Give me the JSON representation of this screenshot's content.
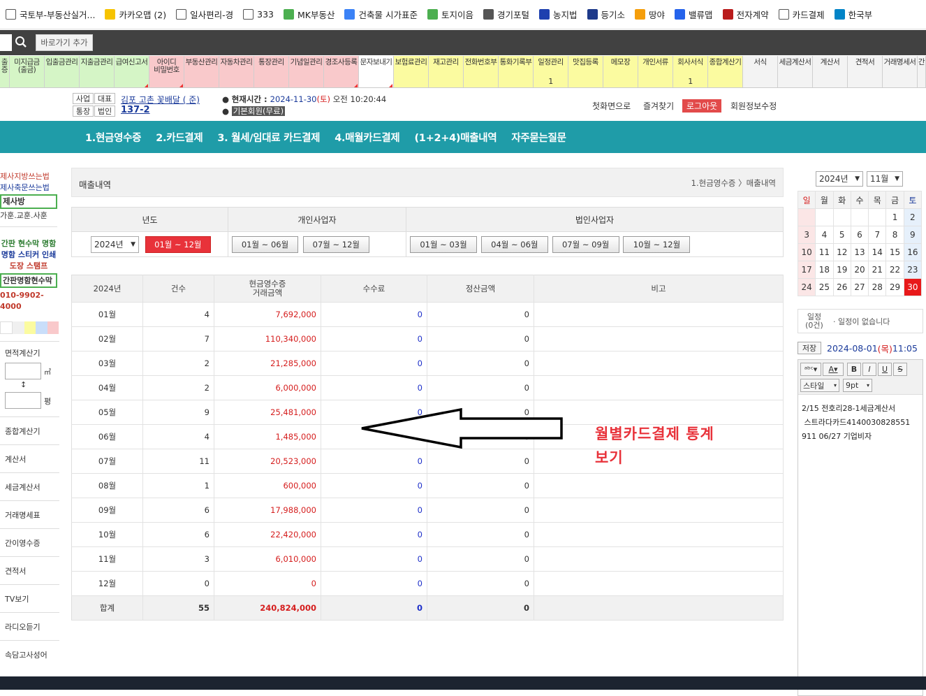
{
  "bookmarks": [
    {
      "label": "국토부-부동산실거...",
      "icon": "page-icon",
      "color": "#ffffff"
    },
    {
      "label": "카카오맵 (2)",
      "icon": "map-pin-icon",
      "color": "#f6c300"
    },
    {
      "label": "일사편리-경",
      "icon": "page-icon",
      "color": "#ffffff"
    },
    {
      "label": "333",
      "icon": "page-icon",
      "color": "#ffffff"
    },
    {
      "label": "MK부동산",
      "icon": "house-icon",
      "color": "#4caf50"
    },
    {
      "label": "건축물 시가표준",
      "icon": "w-icon",
      "color": "#3b82f6"
    },
    {
      "label": "토지이음",
      "icon": "grid-icon",
      "color": "#4caf50"
    },
    {
      "label": "경기포털",
      "icon": "gg-icon",
      "color": "#555555"
    },
    {
      "label": "농지법",
      "icon": "law-icon",
      "color": "#1e40af"
    },
    {
      "label": "등기소",
      "icon": "registry-icon",
      "color": "#1e3a8a"
    },
    {
      "label": "땅야",
      "icon": "land-icon",
      "color": "#f59e0b"
    },
    {
      "label": "밸류맵",
      "icon": "valuemap-icon",
      "color": "#2563eb"
    },
    {
      "label": "전자계약",
      "icon": "seal-icon",
      "color": "#b91c1c"
    },
    {
      "label": "카드결제",
      "icon": "page-icon",
      "color": "#ffffff"
    },
    {
      "label": "한국부",
      "icon": "globe-icon",
      "color": "#0284c7"
    }
  ],
  "toolbar": {
    "shortcut_label": "바로가기 추가"
  },
  "menu": [
    {
      "label": "출\n증",
      "w": 14,
      "cls": "g"
    },
    {
      "label": "미지급금\n(출금)",
      "w": 50,
      "cls": "g"
    },
    {
      "label": "입출금관리",
      "w": 50,
      "cls": "g"
    },
    {
      "label": "지출금관리",
      "w": 50,
      "cls": "g"
    },
    {
      "label": "급여신고서",
      "w": 50,
      "cls": "g",
      "tri": true
    },
    {
      "label": "아이디\n비밀번호",
      "w": 50,
      "cls": "p",
      "tri": true
    },
    {
      "label": "부동산관리",
      "w": 50,
      "cls": "p"
    },
    {
      "label": "자동차관리",
      "w": 50,
      "cls": "p"
    },
    {
      "label": "통장관리",
      "w": 50,
      "cls": "p"
    },
    {
      "label": "기념일관리",
      "w": 50,
      "cls": "p"
    },
    {
      "label": "경조사등록",
      "w": 50,
      "cls": "p",
      "tri": true
    },
    {
      "label": "문자보내기",
      "w": 50,
      "cls": "w",
      "tri": true
    },
    {
      "label": "보험료관리",
      "w": 50,
      "cls": "y"
    },
    {
      "label": "재고관리",
      "w": 50,
      "cls": "y"
    },
    {
      "label": "전화번호부",
      "w": 50,
      "cls": "y"
    },
    {
      "label": "통화기록부",
      "w": 50,
      "cls": "y"
    },
    {
      "label": "일정관리",
      "w": 50,
      "cls": "y",
      "count": "1"
    },
    {
      "label": "맛집등록",
      "w": 50,
      "cls": "y"
    },
    {
      "label": "메모장",
      "w": 50,
      "cls": "y"
    },
    {
      "label": "개인서류",
      "w": 50,
      "cls": "y"
    },
    {
      "label": "회사서식",
      "w": 50,
      "cls": "y",
      "count": "1"
    },
    {
      "label": "종합계산기",
      "w": 50,
      "cls": "y"
    },
    {
      "label": "서식",
      "w": 50,
      "cls": "lg"
    },
    {
      "label": "세금계산서",
      "w": 50,
      "cls": "lg"
    },
    {
      "label": "계산서",
      "w": 50,
      "cls": "lg"
    },
    {
      "label": "견적서",
      "w": 50,
      "cls": "lg"
    },
    {
      "label": "거래명세서",
      "w": 50,
      "cls": "lg"
    },
    {
      "label": "간",
      "w": 12,
      "cls": "lg"
    }
  ],
  "info": {
    "tag1": "사업",
    "tag2": "대표",
    "tag3": "통장",
    "tag4": "법인",
    "company": "김포 고촌 꽃배달 (     준)",
    "bizno": "137-2     ",
    "time_label": "현재시간 : ",
    "time_value": "2024-11-30",
    "time_day": "(토)",
    "time_rest": " 오전 10:20:44",
    "member": "기본회원(무료)",
    "links": [
      "첫화면으로",
      "즐겨찾기"
    ],
    "logout": "로그아웃",
    "member_edit": "회원정보수정"
  },
  "teal_menu": [
    "1.현금영수증",
    "2.카드결제",
    "3. 월세/임대료 카드결제",
    "4.매월카드결제",
    "(1+2+4)매출내역",
    "자주묻는질문"
  ],
  "left": {
    "l1": "제사지방쓰는법",
    "l2": "제사축문쓰는법",
    "l3": "제사방",
    "l4": "가훈.교훈.사훈",
    "ad1": "간판 현수막 명함",
    "ad2": "명함 스티커 인쇄",
    "ad3": "도장 스탬프",
    "ad4": "간판명함현수막",
    "phone": "010-9902-4000",
    "calc_title": "면적계산기",
    "unit1": "㎡",
    "unit2": "평",
    "items": [
      "종합계산기",
      "계산서",
      "세금계산서",
      "거래명세표",
      "간이영수증",
      "견적서",
      "TV보기",
      "라디오듣기",
      "속담고사성어"
    ]
  },
  "main": {
    "title": "매출내역",
    "breadcrumb1": "1.현금영수증",
    "breadcrumb2": "매출내역",
    "filter": {
      "h_year": "년도",
      "h_personal": "개인사업자",
      "h_corp": "법인사업자",
      "year_value": "2024년",
      "btn_all": "01월 ~ 12월",
      "personal": [
        "01월 ~ 06월",
        "07월 ~ 12월"
      ],
      "corp": [
        "01월 ~ 03월",
        "04월 ~ 06월",
        "07월 ~ 09월",
        "10월 ~ 12월"
      ]
    },
    "table": {
      "headers": [
        "2024년",
        "건수",
        "현금영수증\n거래금액",
        "수수료",
        "정산금액",
        "비고"
      ],
      "rows": [
        [
          "01월",
          "4",
          "7,692,000",
          "0",
          "0"
        ],
        [
          "02월",
          "7",
          "110,340,000",
          "0",
          "0"
        ],
        [
          "03월",
          "2",
          "21,285,000",
          "0",
          "0"
        ],
        [
          "04월",
          "2",
          "6,000,000",
          "0",
          "0"
        ],
        [
          "05월",
          "9",
          "25,481,000",
          "0",
          "0"
        ],
        [
          "06월",
          "4",
          "1,485,000",
          "0",
          "0"
        ],
        [
          "07월",
          "11",
          "20,523,000",
          "0",
          "0"
        ],
        [
          "08월",
          "1",
          "600,000",
          "0",
          "0"
        ],
        [
          "09월",
          "6",
          "17,988,000",
          "0",
          "0"
        ],
        [
          "10월",
          "6",
          "22,420,000",
          "0",
          "0"
        ],
        [
          "11월",
          "3",
          "6,010,000",
          "0",
          "0"
        ],
        [
          "12월",
          "0",
          "0",
          "0",
          "0"
        ]
      ],
      "total": [
        "합계",
        "55",
        "240,824,000",
        "0",
        "0"
      ]
    }
  },
  "annotation": {
    "line1": "월별카드결제 통계",
    "line2": "보기"
  },
  "right": {
    "year": "2024년",
    "month": "11월",
    "weekdays": [
      "일",
      "월",
      "화",
      "수",
      "목",
      "금",
      "토"
    ],
    "weeks": [
      [
        "",
        "",
        "",
        "",
        "",
        "1",
        "2"
      ],
      [
        "3",
        "4",
        "5",
        "6",
        "7",
        "8",
        "9"
      ],
      [
        "10",
        "11",
        "12",
        "13",
        "14",
        "15",
        "16"
      ],
      [
        "17",
        "18",
        "19",
        "20",
        "21",
        "22",
        "23"
      ],
      [
        "24",
        "25",
        "26",
        "27",
        "28",
        "29",
        "30"
      ]
    ],
    "today": "30",
    "sched_label": "일정\n(0건)",
    "sched_none": "· 일정이 없습니다",
    "save": "저장",
    "memo_date": "2024-08-01",
    "memo_day": "(목)",
    "memo_time": " 11:05",
    "style_sel": "스타일",
    "size_sel": "9pt",
    "memo_text": [
      "2/15 전호리28-1세금계산서",
      " 스트라다카드4140030828551",
      "911 06/27 기업비자"
    ]
  }
}
